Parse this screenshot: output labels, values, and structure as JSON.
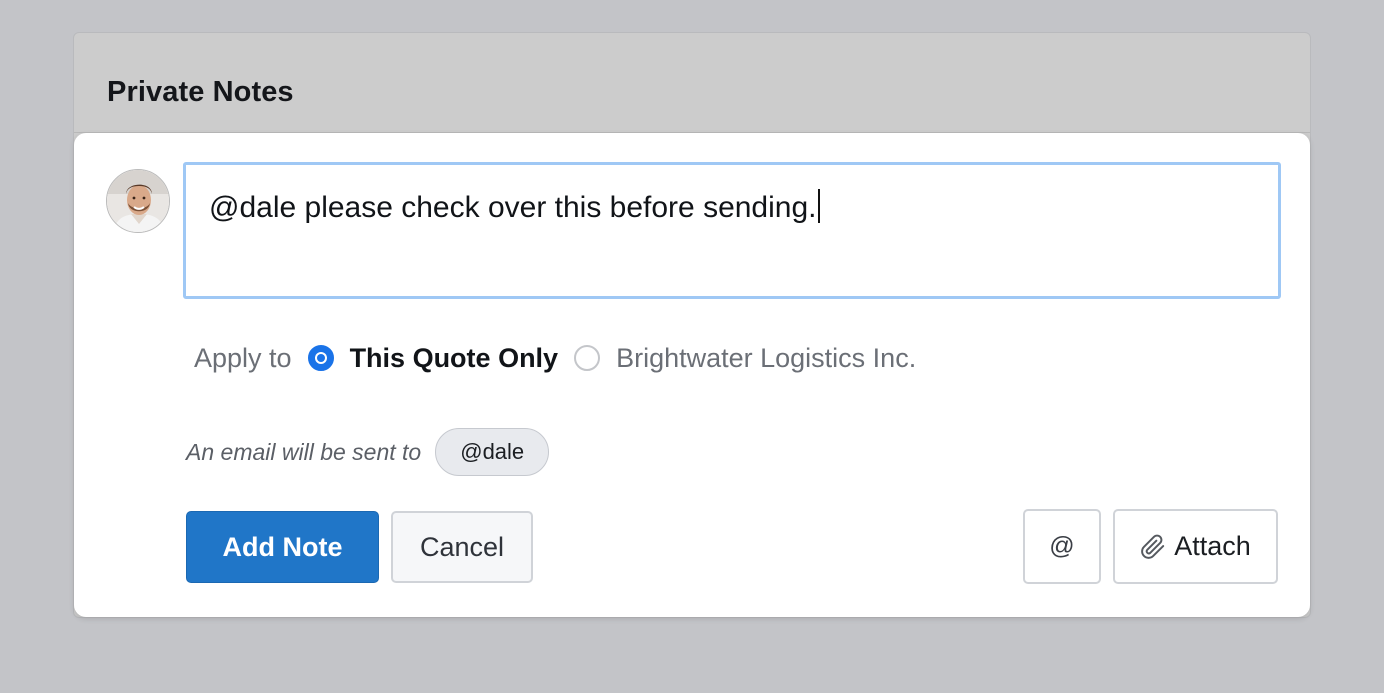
{
  "panel": {
    "title": "Private Notes"
  },
  "note": {
    "value": "@dale please check over this before sending.",
    "avatar_icon": "user-avatar"
  },
  "apply": {
    "label": "Apply to",
    "options": [
      {
        "label": "This Quote Only",
        "selected": true
      },
      {
        "label": "Brightwater Logistics Inc.",
        "selected": false
      }
    ]
  },
  "email": {
    "text": "An email will be sent to",
    "recipient": "@dale"
  },
  "actions": {
    "add_label": "Add Note",
    "cancel_label": "Cancel",
    "mention_label": "@",
    "attach_label": "Attach",
    "attach_icon": "paperclip-icon"
  },
  "colors": {
    "primary": "#2076c8",
    "focus_border": "#9fc8f5",
    "radio_accent": "#1a73e8"
  }
}
